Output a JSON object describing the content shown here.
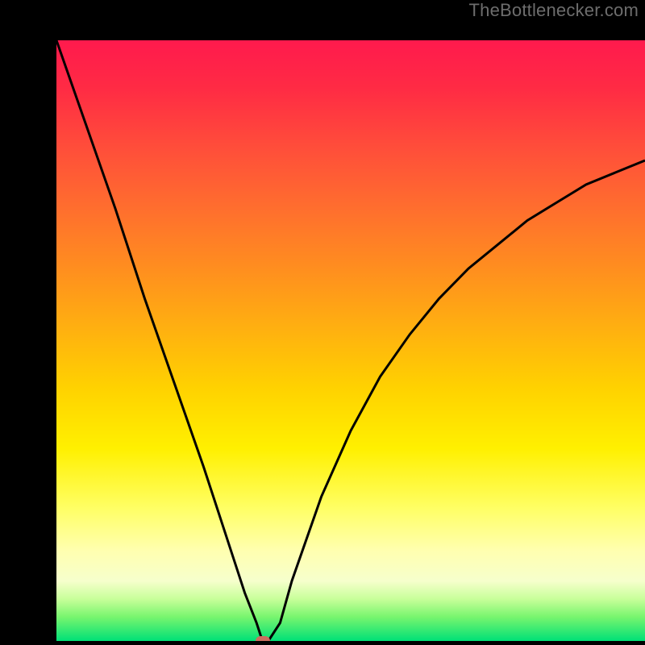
{
  "watermark": "TheBottlenecker.com",
  "chart_data": {
    "type": "line",
    "title": "",
    "xlabel": "",
    "ylabel": "",
    "xlim": [
      0,
      100
    ],
    "ylim": [
      0,
      100
    ],
    "x": [
      0,
      5,
      10,
      15,
      20,
      25,
      27,
      30,
      32,
      34,
      35,
      36,
      38,
      40,
      45,
      50,
      55,
      60,
      65,
      70,
      75,
      80,
      85,
      90,
      95,
      100
    ],
    "values": [
      100,
      86,
      72,
      57,
      43,
      29,
      23,
      14,
      8,
      3,
      0,
      0,
      3,
      10,
      24,
      35,
      44,
      51,
      57,
      62,
      66,
      70,
      73,
      76,
      78,
      80
    ],
    "marker": {
      "x": 35,
      "y": 0
    },
    "background_gradient": {
      "top": "#ff1a4d",
      "mid": "#ffd200",
      "bottom": "#00e077"
    }
  }
}
